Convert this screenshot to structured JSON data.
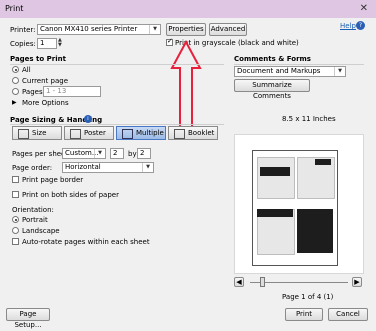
{
  "window": {
    "title": "Print",
    "help_label": "Help"
  },
  "printer": {
    "label": "Printer:",
    "value": "Canon MX410 series Printer",
    "properties_label": "Properties",
    "advanced_label": "Advanced"
  },
  "copies": {
    "label": "Copies:",
    "value": "1"
  },
  "grayscale": {
    "label": "Print in grayscale (black and white)",
    "checked": true
  },
  "pages": {
    "section_title": "Pages to Print",
    "all": "All",
    "current": "Current page",
    "pages": "Pages",
    "range_placeholder": "1 - 13",
    "more_options": "More Options"
  },
  "sizing": {
    "section_title": "Page Sizing & Handling",
    "tabs": [
      "Size",
      "Poster",
      "Multiple",
      "Booklet"
    ],
    "pages_per_sheet_label": "Pages per sheet:",
    "pages_per_sheet_value": "Custom...",
    "cols": "2",
    "by": "by",
    "rows": "2",
    "order_label": "Page order:",
    "order_value": "Horizontal",
    "border_label": "Print page border",
    "both_sides_label": "Print on both sides of paper"
  },
  "orientation": {
    "title": "Orientation:",
    "portrait": "Portrait",
    "landscape": "Landscape",
    "auto_rotate": "Auto-rotate pages within each sheet"
  },
  "comments": {
    "section_title": "Comments & Forms",
    "value": "Document and Markups",
    "summarize_label": "Summarize Comments"
  },
  "preview": {
    "size_label": "8.5 x 11 Inches",
    "page_label": "Page 1 of 4 (1)"
  },
  "footer": {
    "setup_label": "Page Setup...",
    "print_label": "Print",
    "cancel_label": "Cancel"
  },
  "colors": {
    "titlebar": "#dfc7e3",
    "annotation_arrow": "#e8203b",
    "selected_tab": "#9bbbe6"
  }
}
